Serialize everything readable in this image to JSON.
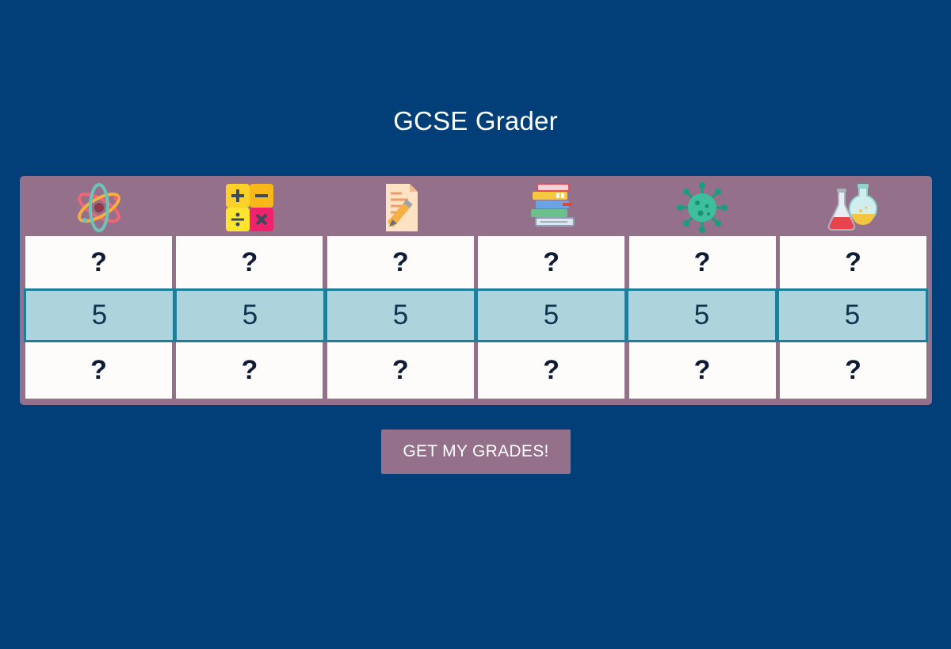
{
  "page": {
    "title": "GCSE Grader"
  },
  "subjects": [
    {
      "icon": "physics-atom-icon"
    },
    {
      "icon": "maths-calculator-icon"
    },
    {
      "icon": "english-document-pencil-icon"
    },
    {
      "icon": "books-stack-icon"
    },
    {
      "icon": "biology-virus-icon"
    },
    {
      "icon": "chemistry-flasks-icon"
    }
  ],
  "grid": {
    "upper_row": [
      "?",
      "?",
      "?",
      "?",
      "?",
      "?"
    ],
    "selected_row": [
      "5",
      "5",
      "5",
      "5",
      "5",
      "5"
    ],
    "lower_row": [
      "?",
      "?",
      "?",
      "?",
      "?",
      "?"
    ]
  },
  "action": {
    "button_label": "GET MY GRADES!"
  },
  "colors": {
    "background": "#023e78",
    "panel": "#94708a",
    "cell": "#fdfcfb",
    "selected_cell": "#add3dc",
    "selected_border": "#1f7f9a",
    "button": "#94708a"
  }
}
